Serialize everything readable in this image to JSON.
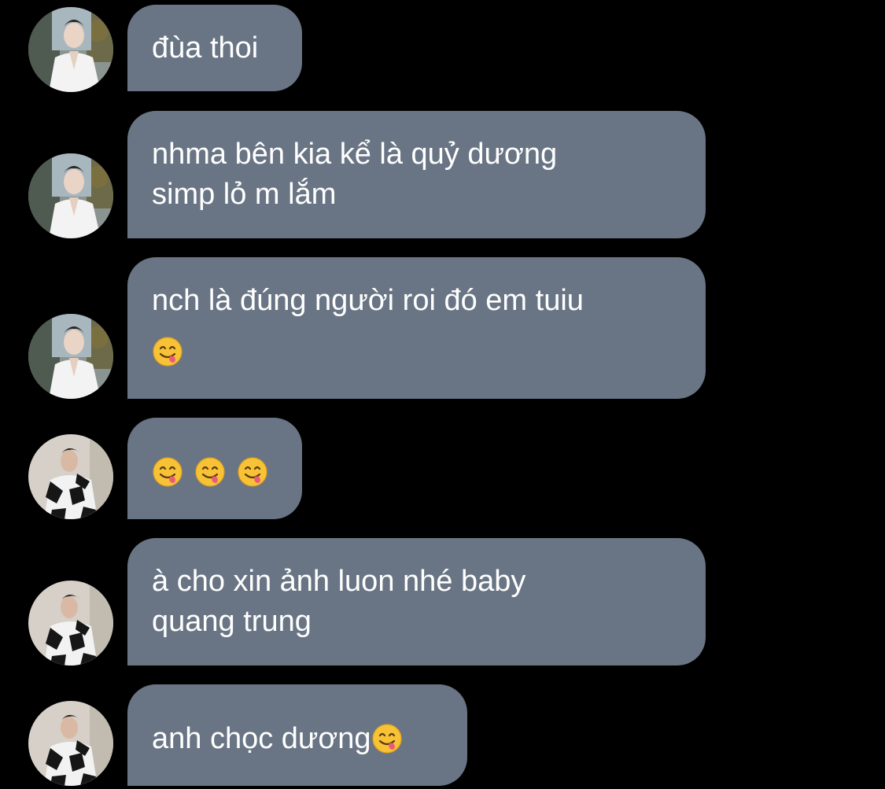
{
  "colors": {
    "background": "#000000",
    "bubble": "#697584",
    "text": "#ffffff"
  },
  "messages": [
    {
      "sender": "avatar-a",
      "lines": [
        "đùa thoi"
      ]
    },
    {
      "sender": "avatar-a",
      "lines": [
        "nhma bên kia kể là quỷ dương",
        "simp lỏ m lắm"
      ]
    },
    {
      "sender": "avatar-a",
      "lines": [
        "nch là đúng người roi đó em tuiu"
      ],
      "emoji_line": "face-savoring-food-emoji"
    },
    {
      "sender": "avatar-b",
      "emoji_only": [
        "face-savoring-food-emoji",
        "face-savoring-food-emoji",
        "face-savoring-food-emoji"
      ]
    },
    {
      "sender": "avatar-b",
      "lines": [
        "à cho xin ảnh luon nhé baby",
        "quang trung"
      ]
    },
    {
      "sender": "avatar-b",
      "lines": [
        "anh chọc dương"
      ],
      "trailing_emoji": "face-savoring-food-emoji"
    }
  ]
}
